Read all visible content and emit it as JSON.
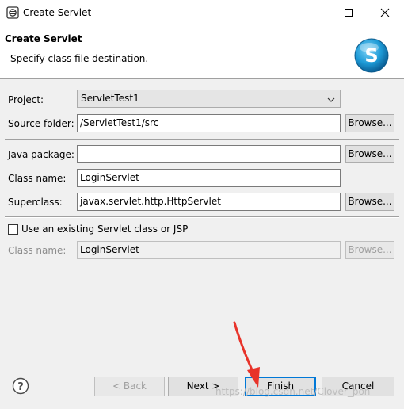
{
  "window": {
    "title": "Create Servlet",
    "title_icon": "eclipse-icon",
    "controls": [
      "minimize-icon",
      "maximize-icon",
      "close-icon"
    ]
  },
  "banner": {
    "title": "Create Servlet",
    "message": "Specify class file destination.",
    "logo": "servlet-wizard-logo",
    "logo_letter": "S"
  },
  "form": {
    "project_label": "Project:",
    "project_value": "ServletTest1",
    "source_folder_label": "Source folder:",
    "source_folder_value": "/ServletTest1/src",
    "java_package_label": "Java package:",
    "java_package_value": "",
    "class_name_label": "Class name:",
    "class_name_value": "LoginServlet",
    "superclass_label": "Superclass:",
    "superclass_value": "javax.servlet.http.HttpServlet",
    "browse_label": "Browse...",
    "existing_checkbox_label": "Use an existing Servlet class or JSP",
    "existing_checked": false,
    "existing_class_label": "Class name:",
    "existing_class_value": "LoginServlet"
  },
  "footer": {
    "help_icon": "help-icon",
    "back_label": "< Back",
    "next_label": "Next >",
    "finish_label": "Finish",
    "cancel_label": "Cancel"
  },
  "watermark": "https://blog.csdn.net/Clover_pon",
  "annotation_color": "#e8332a",
  "accent_color": "#0078d7"
}
